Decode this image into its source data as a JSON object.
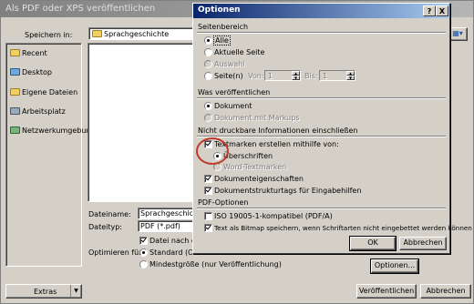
{
  "save_dialog": {
    "title": "Als PDF oder XPS veröffentlichen",
    "save_in_label": "Speichern in:",
    "save_in_value": "Sprachgeschichte",
    "places": [
      {
        "label": "Recent",
        "icon": "recent-folder-icon"
      },
      {
        "label": "Desktop",
        "icon": "desktop-icon"
      },
      {
        "label": "Eigene Dateien",
        "icon": "my-documents-icon"
      },
      {
        "label": "Arbeitsplatz",
        "icon": "my-computer-icon"
      },
      {
        "label": "Netzwerkumgebung",
        "icon": "network-icon"
      }
    ],
    "filename_label": "Dateiname:",
    "filename_value": "Sprachgeschichte.",
    "filetype_label": "Dateityp:",
    "filetype_value": "PDF (*.pdf)",
    "open_after_label": "Datei nach dem",
    "optimize_label": "Optimieren für:",
    "optimize_standard": "Standard (Onlin",
    "optimize_min": "Mindestgröße (nur Veröffentlichung)",
    "options_button": "Optionen...",
    "tools_button": "Extras",
    "publish_button": "Veröffentlichen",
    "cancel_button": "Abbrechen"
  },
  "options_dialog": {
    "title": "Optionen",
    "help_button": "?",
    "close_button": "X",
    "page_range": {
      "heading": "Seitenbereich",
      "all": "Alle",
      "current": "Aktuelle Seite",
      "selection": "Auswahl",
      "pages": "Seite(n)",
      "from": "Von:",
      "from_value": "1",
      "to": "Bis:",
      "to_value": "1"
    },
    "publish_what": {
      "heading": "Was veröffentlichen",
      "document": "Dokument",
      "document_markup": "Dokument mit Markups"
    },
    "nonprint": {
      "heading": "Nicht druckbare Informationen einschließen",
      "bookmarks": "Textmarken erstellen mithilfe von:",
      "headings": "Überschriften",
      "word_bookmarks": "Word-Textmarken",
      "doc_properties": "Dokumenteigenschaften",
      "structure_tags": "Dokumentstrukturtags für Eingabehilfen"
    },
    "pdf_options": {
      "heading": "PDF-Optionen",
      "iso": "ISO 19005-1-kompatibel (PDF/A)",
      "bitmap": "Text als Bitmap speichern, wenn Schriftarten nicht eingebettet werden können"
    },
    "ok_button": "OK",
    "cancel_button": "Abbrechen"
  },
  "colors": {
    "title_active": "#0a246a",
    "highlight_circle": "#c0392b"
  }
}
